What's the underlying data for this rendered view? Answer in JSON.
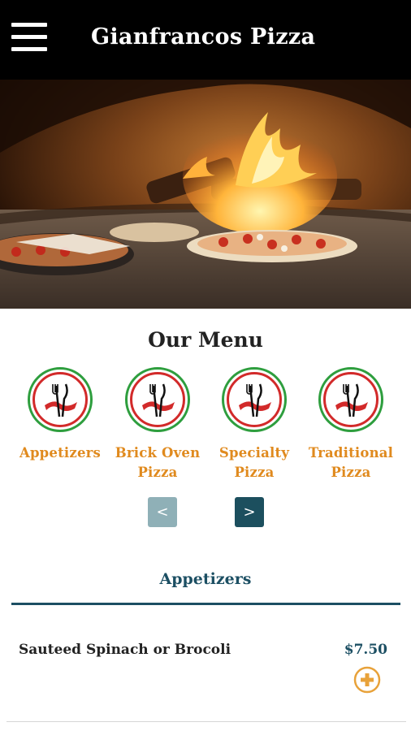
{
  "header": {
    "title": "Gianfrancos Pizza",
    "menu_icon": "hamburger-menu-icon",
    "background_color": "#000000"
  },
  "hero": {
    "image": "wood-fired-pizza-oven-photo"
  },
  "menu": {
    "title": "Our Menu",
    "categories": [
      {
        "label_line1": "Appetizers",
        "label_line2": "",
        "icon": "fork-knife-ribbon-icon"
      },
      {
        "label_line1": "Brick Oven",
        "label_line2": "Pizza",
        "icon": "fork-knife-ribbon-icon"
      },
      {
        "label_line1": "Specialty",
        "label_line2": "Pizza",
        "icon": "fork-knife-ribbon-icon"
      },
      {
        "label_line1": "Traditional",
        "label_line2": "Pizza",
        "icon": "fork-knife-ribbon-icon"
      }
    ],
    "prev_label": "<",
    "next_label": ">"
  },
  "section": {
    "title": "Appetizers",
    "items": [
      {
        "name": "Sauteed Spinach or Brocoli",
        "price": "$7.50",
        "add_icon": "plus-circle-icon"
      }
    ]
  },
  "colors": {
    "accent_orange": "#e08a1e",
    "teal_dark": "#1c4f63",
    "nav_prev": "#8fb0b7",
    "nav_next": "#1c4f5e",
    "ring_green": "#2e9e3e",
    "ring_red": "#d22a2a"
  }
}
